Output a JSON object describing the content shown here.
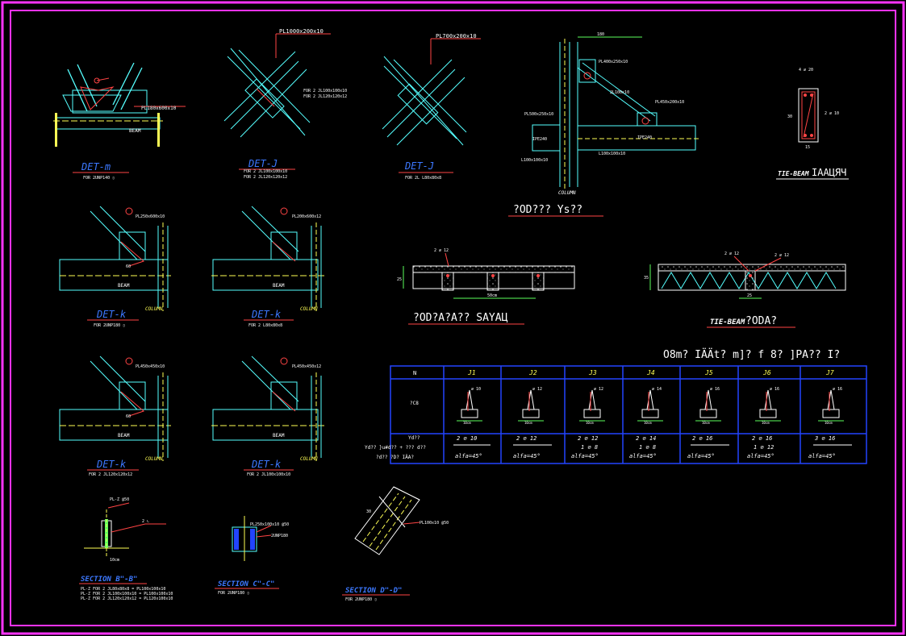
{
  "colors": {
    "background": "#000000",
    "frame": "#ff33ff",
    "steel": "#55ffff",
    "annot": "#ff4444",
    "dim": "#5dff5d",
    "caption": "#3c78ff",
    "text": "#ffffff",
    "weld": "#ffff55",
    "concrete": "#cccccc"
  },
  "details": {
    "det_m": {
      "title": "DET-m",
      "note": "FOR 2UNP140 ▯",
      "plate": "PL180x600x10",
      "beam": "BEAM"
    },
    "det_j1": {
      "title": "DET-J",
      "plate": "PL1000x200x10",
      "note1": "FOR 2 JL100x100x10",
      "note2": "FOR 2 JL120x120x12",
      "side1": "FOR 2 JL100x100x10",
      "side2": "FOR 2 JL120x120x12"
    },
    "det_j2": {
      "title": "DET-J",
      "plate": "PL700x200x10",
      "note": "FOR 2L L80x80x8"
    },
    "column_det": {
      "title": "COLUMN",
      "dim_top": "180",
      "p1": "PL400x250x10",
      "p2": "PL450x200x10",
      "p3": "PL500x250x10",
      "p4": "L100x100x10",
      "p5": "L100x100x10",
      "p6": "IPE240",
      "p7": "IPE240",
      "p8": "L100x100x10",
      "brace": "2L100x10",
      "caption": "?OD??? Ys??"
    },
    "tie": {
      "title": "TIE-BEAM",
      "caption": "IAAЦЯЧ",
      "top": "4 ∅ 20",
      "side": "2 ∅ 10",
      "d1": "30",
      "d2": "15"
    },
    "det_k1": {
      "title": "DET-k",
      "plate": "PL250x600x10",
      "note": "FOR 2UNP180 ▯",
      "beam": "BEAM",
      "column": "COLUMN",
      "d1": "60",
      "d2": "30"
    },
    "det_k2": {
      "title": "DET-k",
      "plate": "PL200x600x12",
      "note": "FOR 2 L80x80x8",
      "beam": "BEAM",
      "column": "COLUMN"
    },
    "det_k3": {
      "title": "DET-k",
      "plate": "PL450x450x10",
      "note": "FOR 2 JL120x120x12",
      "beam": "BEAM",
      "column": "COLUMN",
      "d1": "60",
      "d2": "30"
    },
    "det_k4": {
      "title": "DET-k",
      "plate": "PL450x450x12",
      "note": "FOR 2 JL100x100x10",
      "beam": "BEAM",
      "column": "COLUMN"
    },
    "slab1": {
      "caption": "?OD?A?A?? SAYAЦ",
      "dim": "50cm",
      "bars": "2 ∅ 12",
      "h": "25"
    },
    "slab2": {
      "caption": "?ODA?",
      "tie": "TIE-BEAM",
      "dim": "25",
      "bars1": "2 ∅ 12",
      "bars2": "2 ∅ 12",
      "h": "35"
    },
    "sec_b": {
      "title": "SECTION B\"-B\"",
      "note1": "PL-Z FOR 2 JL80x80x8 = PL100x100x10",
      "note2": "PL-Z FOR 2 JL100x100x10 = PL100x100x10",
      "note3": "PL-Z FOR 2 JL120x120x12 = PL120x100x10",
      "plate": "PL-Z @50",
      "ang": "2 ∟",
      "dim": "10cm"
    },
    "sec_c": {
      "title": "SECTION C\"-C\"",
      "note": "FOR 2UNP180 ▯",
      "plate": "PL250x100x10 @50",
      "chan": "2UNP180"
    },
    "sec_d": {
      "title": "SECTION D\"-D\"",
      "note": "FOR 2UNP180 ▯",
      "plate": "PL100x10 @50",
      "dim": "30"
    }
  },
  "table": {
    "title": "O8m? IÄÄt? m]? f 8? ]PA?? I?",
    "header_row_label": "N",
    "columns": [
      "J1",
      "J2",
      "J3",
      "J4",
      "J5",
      "J6",
      "J7"
    ],
    "row_labels": [
      "?C8",
      "Yd??",
      "Yd?? }u#d?? + ??? d??",
      "?d?? ?D? IÄA?"
    ],
    "long_bar": [
      "2 ∅ 10",
      "2 ∅ 12",
      "2 ∅ 12",
      "2 ∅ 14",
      "2 ∅ 16",
      "2 ∅ 16",
      "3 ∅ 16"
    ],
    "stirrups": [
      "",
      "",
      "1 ∅ 8",
      "1 ∅ 8",
      "",
      "1 ∅ 12",
      ""
    ],
    "angle": [
      "alfa=45°",
      "alfa=45°",
      "alfa=45°",
      "alfa=45°",
      "alfa=45°",
      "alfa=45°",
      "alfa=45°"
    ],
    "bar_label": [
      "∅ 10",
      "∅ 12",
      "∅ 12",
      "∅ 14",
      "∅ 16",
      "∅ 16",
      "∅ 16"
    ],
    "dim_label": "10cm"
  }
}
